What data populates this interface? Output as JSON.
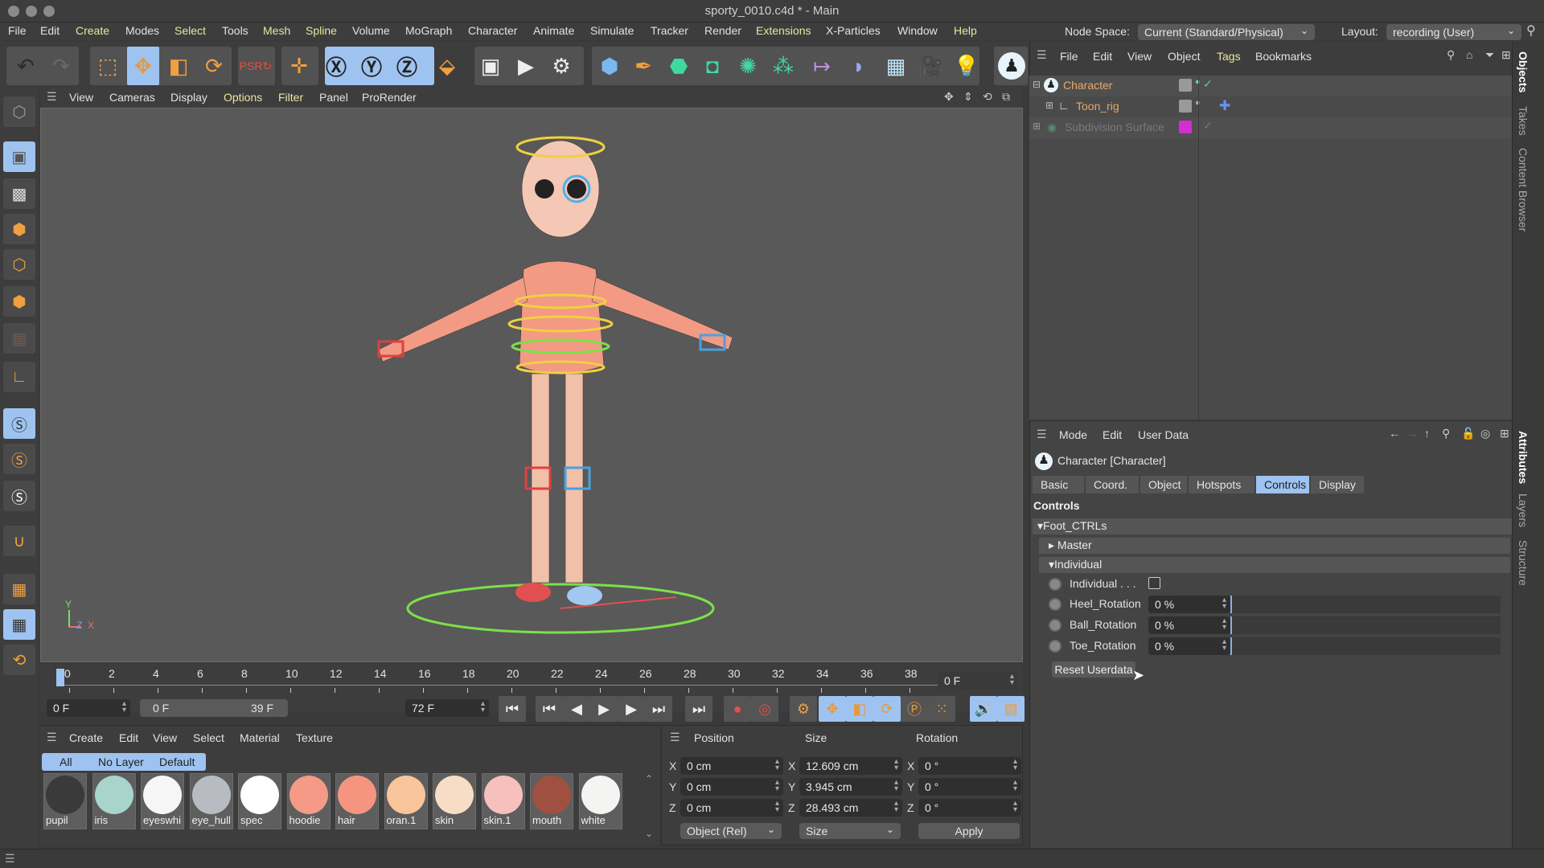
{
  "window": {
    "title": "sporty_0010.c4d * - Main"
  },
  "menubar": {
    "items": [
      {
        "label": "File",
        "highlight": false
      },
      {
        "label": "Edit",
        "highlight": false
      },
      {
        "label": "Create",
        "highlight": true
      },
      {
        "label": "Modes",
        "highlight": false
      },
      {
        "label": "Select",
        "highlight": true
      },
      {
        "label": "Tools",
        "highlight": false
      },
      {
        "label": "Mesh",
        "highlight": true
      },
      {
        "label": "Spline",
        "highlight": true
      },
      {
        "label": "Volume",
        "highlight": false
      },
      {
        "label": "MoGraph",
        "highlight": false
      },
      {
        "label": "Character",
        "highlight": false
      },
      {
        "label": "Animate",
        "highlight": false
      },
      {
        "label": "Simulate",
        "highlight": false
      },
      {
        "label": "Tracker",
        "highlight": false
      },
      {
        "label": "Render",
        "highlight": false
      },
      {
        "label": "Extensions",
        "highlight": true
      },
      {
        "label": "X-Particles",
        "highlight": false
      },
      {
        "label": "Window",
        "highlight": false
      },
      {
        "label": "Help",
        "highlight": true
      }
    ],
    "node_space_label": "Node Space:",
    "node_space_value": "Current (Standard/Physical)",
    "layout_label": "Layout:",
    "layout_value": "recording (User)"
  },
  "toolbar": {
    "icons": [
      "undo-icon",
      "redo-icon",
      "live-selection-icon",
      "move-icon",
      "scale-icon",
      "rotate-icon",
      "psr-reset-icon",
      "transform-icon",
      "x-axis-lock-icon",
      "y-axis-lock-icon",
      "z-axis-lock-icon",
      "coordinate-system-icon",
      "render-view-icon",
      "render-picture-viewer-icon",
      "render-settings-icon",
      "cube-icon",
      "pen-icon",
      "subdivision-icon",
      "extrude-icon",
      "cloner-icon",
      "mograph-icon",
      "deformer-icon",
      "bend-icon",
      "floor-icon",
      "camera-icon",
      "light-icon",
      "character-icon"
    ]
  },
  "viewport": {
    "menu": [
      "View",
      "Cameras",
      "Display",
      "Options",
      "Filter",
      "Panel",
      "ProRender"
    ],
    "menu_highlight": [
      "Options",
      "Filter"
    ],
    "axis": {
      "y": "Y",
      "z": "Z",
      "x": "X"
    }
  },
  "timeline": {
    "ticks": [
      "0",
      "2",
      "4",
      "6",
      "8",
      "10",
      "12",
      "14",
      "16",
      "18",
      "20",
      "22",
      "24",
      "26",
      "28",
      "30",
      "32",
      "34",
      "36",
      "38"
    ],
    "current_frame_display": "0 F",
    "start_field": "0 F",
    "range_start": "0 F",
    "range_end": "39 F",
    "end_field": "72 F"
  },
  "material_manager": {
    "menu": [
      "Create",
      "Edit",
      "View",
      "Select",
      "Material",
      "Texture"
    ],
    "filters": [
      "All",
      "No Layer",
      "Default"
    ],
    "materials": [
      {
        "name": "pupil",
        "color": "#3a3a3a"
      },
      {
        "name": "iris",
        "color": "#a8d4cc"
      },
      {
        "name": "eyeswhi",
        "color": "#f6f6f6"
      },
      {
        "name": "eye_hull",
        "color": "#b8bcc2"
      },
      {
        "name": "spec",
        "color": "#ffffff"
      },
      {
        "name": "hoodie",
        "color": "#f49a86"
      },
      {
        "name": "hair",
        "color": "#f59580"
      },
      {
        "name": "oran.1",
        "color": "#f8c49a"
      },
      {
        "name": "skin",
        "color": "#f8ddc6"
      },
      {
        "name": "skin.1",
        "color": "#f6c0bc"
      },
      {
        "name": "mouth",
        "color": "#a05040"
      },
      {
        "name": "white",
        "color": "#f4f4f2"
      }
    ]
  },
  "coordinates": {
    "headers": [
      "Position",
      "Size",
      "Rotation"
    ],
    "position": [
      {
        "axis": "X",
        "value": "0 cm"
      },
      {
        "axis": "Y",
        "value": "0 cm"
      },
      {
        "axis": "Z",
        "value": "0 cm"
      }
    ],
    "size": [
      {
        "axis": "X",
        "value": "12.609 cm"
      },
      {
        "axis": "Y",
        "value": "3.945 cm"
      },
      {
        "axis": "Z",
        "value": "28.493 cm"
      }
    ],
    "rotation": [
      {
        "axis": "X",
        "value": "0 °"
      },
      {
        "axis": "Y",
        "value": "0 °"
      },
      {
        "axis": "Z",
        "value": "0 °"
      }
    ],
    "mode_dropdown": "Object (Rel)",
    "size_dropdown": "Size",
    "apply_label": "Apply"
  },
  "object_manager": {
    "menu": [
      "File",
      "Edit",
      "View",
      "Object",
      "Tags",
      "Bookmarks"
    ],
    "objects": [
      {
        "name": "Character",
        "color": "#e8a868"
      },
      {
        "name": "Toon_rig",
        "color": "#e8a868"
      },
      {
        "name": "Subdivision Surface",
        "color": "#777"
      }
    ]
  },
  "attribute_manager": {
    "menu": [
      "Mode",
      "Edit",
      "User Data"
    ],
    "object_title": "Character [Character]",
    "tabs": [
      "Basic",
      "Coord.",
      "Object",
      "Hotspots",
      "Controls",
      "Display"
    ],
    "active_tab": "Controls",
    "section_title": "Controls",
    "group_foot": "Foot_CTRLs",
    "group_master": "Master",
    "group_individual": "Individual",
    "params": [
      {
        "label": "Individual . . .",
        "type": "checkbox",
        "checked": false
      },
      {
        "label": "Heel_Rotation",
        "type": "slider",
        "value": "0 %"
      },
      {
        "label": "Ball_Rotation",
        "type": "slider",
        "value": "0 %"
      },
      {
        "label": "Toe_Rotation",
        "type": "slider",
        "value": "0 %"
      }
    ],
    "reset_label": "Reset Userdata"
  },
  "right_tabs": {
    "top": [
      "Objects",
      "Takes",
      "Content Browser"
    ],
    "bottom": [
      "Attributes",
      "Layers",
      "Structure"
    ]
  }
}
